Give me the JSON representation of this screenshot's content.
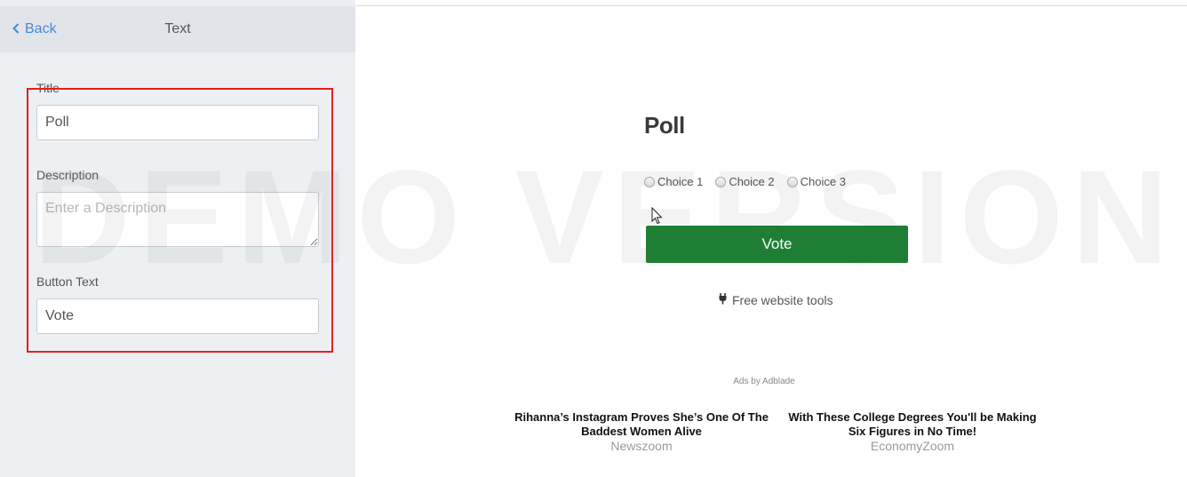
{
  "left_panel": {
    "back_label": "Back",
    "title": "Text",
    "fields": {
      "title_label": "Title",
      "title_value": "Poll",
      "description_label": "Description",
      "description_placeholder": "Enter a Description",
      "button_text_label": "Button Text",
      "button_text_value": "Vote"
    }
  },
  "preview": {
    "watermark": "DEMO VERSION",
    "poll_title": "Poll",
    "choices": [
      "Choice 1",
      "Choice 2",
      "Choice 3"
    ],
    "vote_label": "Vote",
    "free_tools_label": "Free website tools",
    "ads_by": "Ads by Adblade",
    "ads": [
      {
        "title": "Rihanna’s Instagram Proves She’s One Of The Baddest Women Alive",
        "source": "Newszoom"
      },
      {
        "title": "With These College Degrees You'll be Making Six Figures in No Time!",
        "source": "EconomyZoom"
      }
    ]
  },
  "colors": {
    "accent_link": "#4a86d8",
    "vote_button": "#1e7e34",
    "highlight": "#e32020"
  }
}
